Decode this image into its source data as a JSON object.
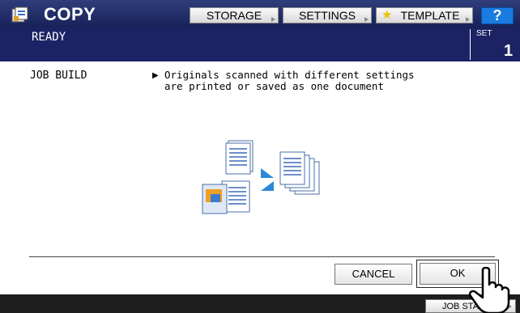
{
  "header": {
    "title": "COPY",
    "app_icon": "copy-icon",
    "buttons": {
      "storage": "STORAGE",
      "settings": "SETTINGS",
      "template": "TEMPLATE",
      "help": "?"
    }
  },
  "status": {
    "text": "READY",
    "set_label": "SET",
    "set_value": "1"
  },
  "main": {
    "function_name": "JOB BUILD",
    "description_line1": "Originals scanned with different settings",
    "description_line2": "are printed or saved as one document",
    "illustration": "job-build-illustration"
  },
  "dialog": {
    "cancel_label": "CANCEL",
    "ok_label": "OK"
  },
  "footer": {
    "job_status_label": "JOB STATUS"
  },
  "colors": {
    "header_bg": "#1f2a66",
    "status_bg": "#1b2364",
    "help_bg": "#1a7be0",
    "footer_bg": "#1e1e1e"
  }
}
